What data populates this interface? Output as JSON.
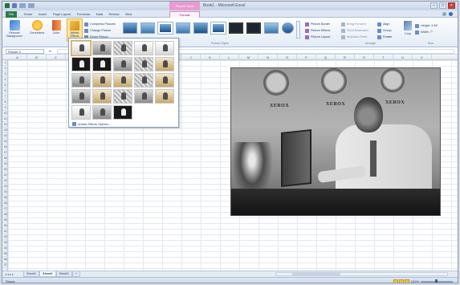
{
  "window": {
    "title": "Book1 - Microsoft Excel",
    "contextual_tab": "Picture Tools"
  },
  "tabs": [
    "File",
    "Home",
    "Insert",
    "Page Layout",
    "Formulas",
    "Data",
    "Review",
    "View",
    "Format"
  ],
  "ribbon": {
    "adjust": {
      "remove_background": "Remove Background",
      "corrections": "Corrections",
      "color": "Color",
      "artistic_effects": "Artistic Effects",
      "compress": "Compress Pictures",
      "change": "Change Picture",
      "reset": "Reset Picture",
      "group_label": "Adjust"
    },
    "styles_group_label": "Picture Styles",
    "picture_border": "Picture Border",
    "picture_effects": "Picture Effects",
    "picture_layout": "Picture Layout",
    "bring_forward": "Bring Forward",
    "send_backward": "Send Backward",
    "selection_pane": "Selection Pane",
    "align": "Align",
    "group": "Group",
    "rotate": "Rotate",
    "arrange_label": "Arrange",
    "crop": "Crop",
    "height": "Height: 4.36\"",
    "width": "Width: 7\"",
    "size_label": "Size"
  },
  "formula_bar": {
    "name_box": "Picture 3",
    "fx": "fx",
    "value": ""
  },
  "columns": [
    "A",
    "B",
    "C",
    "D",
    "E",
    "F",
    "G",
    "H",
    "I",
    "J",
    "K",
    "L",
    "M",
    "N",
    "O",
    "P",
    "Q",
    "R",
    "S",
    "T",
    "U",
    "V"
  ],
  "rows": [
    "1",
    "2",
    "3",
    "4",
    "5",
    "6",
    "7",
    "8",
    "9",
    "10",
    "11",
    "12",
    "13",
    "14",
    "15",
    "16",
    "17",
    "18",
    "19",
    "20",
    "21",
    "22",
    "23",
    "24",
    "25",
    "26",
    "27",
    "28",
    "29",
    "30",
    "31",
    "32",
    "33",
    "34",
    "35",
    "36",
    "37"
  ],
  "photo": {
    "logo_left": "XEROX",
    "logo_center": "XEROX",
    "logo_right": "XEROX"
  },
  "gallery": {
    "options_label": "Artistic Effects Options..."
  },
  "sheets": [
    "Sheet1",
    "Sheet2",
    "Sheet3"
  ],
  "active_sheet": "Sheet2",
  "status": {
    "text": "Ready",
    "zoom": "100%"
  }
}
